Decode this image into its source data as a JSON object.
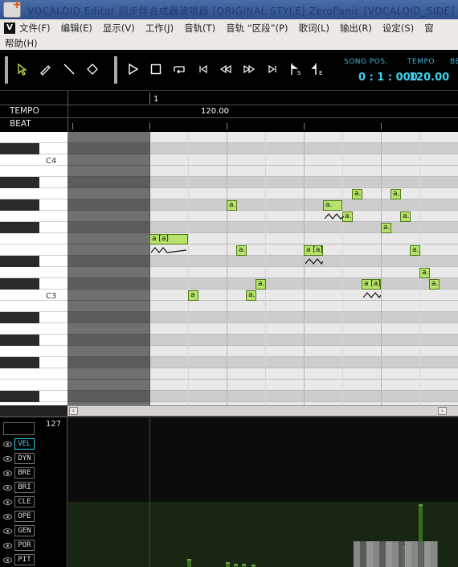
{
  "window": {
    "title": "VOCALOID Editor  同步伴合成器演唱器    [ORIGINAL STYLE]    ZeroPanic   [VOCALOID_SIDE]"
  },
  "menu": {
    "logo": "V",
    "items": [
      "文件(F)",
      "编辑(E)",
      "显示(V)",
      "工作(J)",
      "音轨(T)",
      "音轨 “区段”(P)",
      "歌词(L)",
      "输出(R)",
      "设定(S)",
      "窗"
    ],
    "items_row2": [
      "帮助(H)"
    ]
  },
  "toolbar": {
    "song_pos_label": "SONG POS.",
    "song_pos_value": "0 : 1 : 000",
    "tempo_label": "TEMPO",
    "tempo_value": "120.00",
    "beat_label": "BE"
  },
  "ruler": {
    "tempo_label": "TEMPO",
    "beat_label": "BEAT",
    "measure_number": "1",
    "tempo_value": "120.00"
  },
  "piano": {
    "c4_label": "C4",
    "c3_label": "C3"
  },
  "notes": [
    {
      "lyric": "a [a]"
    },
    {
      "lyric": "a."
    },
    {
      "lyric": "a."
    },
    {
      "lyric": "a."
    },
    {
      "lyric": "a."
    },
    {
      "lyric": "a [a]"
    },
    {
      "lyric": "a [a]"
    },
    {
      "lyric": "a."
    },
    {
      "lyric": "a."
    },
    {
      "lyric": "a [a]"
    },
    {
      "lyric": "a."
    },
    {
      "lyric": "a."
    },
    {
      "lyric": "a."
    },
    {
      "lyric": "a."
    },
    {
      "lyric": "a."
    },
    {
      "lyric": "a."
    },
    {
      "lyric": "a."
    }
  ],
  "control_track": {
    "max_value": "127",
    "params": [
      "VEL",
      "DYN",
      "BRE",
      "BRI",
      "CLE",
      "OPE",
      "GEN",
      "POR",
      "PIT"
    ],
    "active": "VEL"
  },
  "colors": {
    "accent": "#3fd4f0",
    "note_fill": "#b7e36a",
    "lane_light": "#e9e9e9",
    "lane_dark": "#cdcdcd",
    "velocity": "#3a6e1e"
  }
}
